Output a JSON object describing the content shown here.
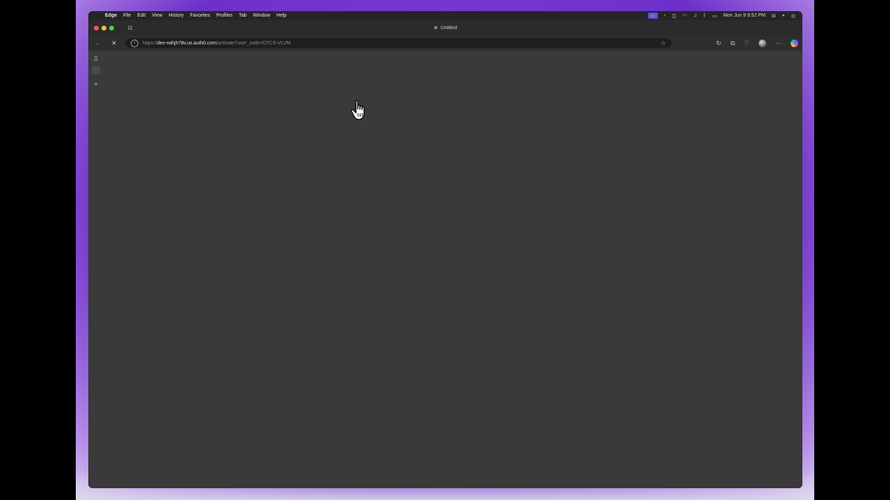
{
  "menubar": {
    "apple": "",
    "app_name": "Edge",
    "items": [
      "File",
      "Edit",
      "View",
      "History",
      "Favorites",
      "Profiles",
      "Tab",
      "Window",
      "Help"
    ],
    "datetime": "Mon Jun 9  9:52 PM"
  },
  "window": {
    "tab_title": "Untitled",
    "url_host": "https://dev-rwhjh78v.us.auth0.com",
    "url_prefix": "https://",
    "url_domain": "dev-rwhjh78v.us.auth0.com",
    "url_path": "/activate?user_code=DTCS-VLVM"
  },
  "icons": {
    "stop": "✕",
    "back": "←",
    "star": "☆",
    "info": "i",
    "new_tab": "+",
    "more": "···"
  },
  "colors": {
    "desktop_purple": "#7a36d6",
    "window_bg": "#3a3a3a",
    "toolbar_bg": "#2e2e2e",
    "menubar_bg": "#262526"
  }
}
